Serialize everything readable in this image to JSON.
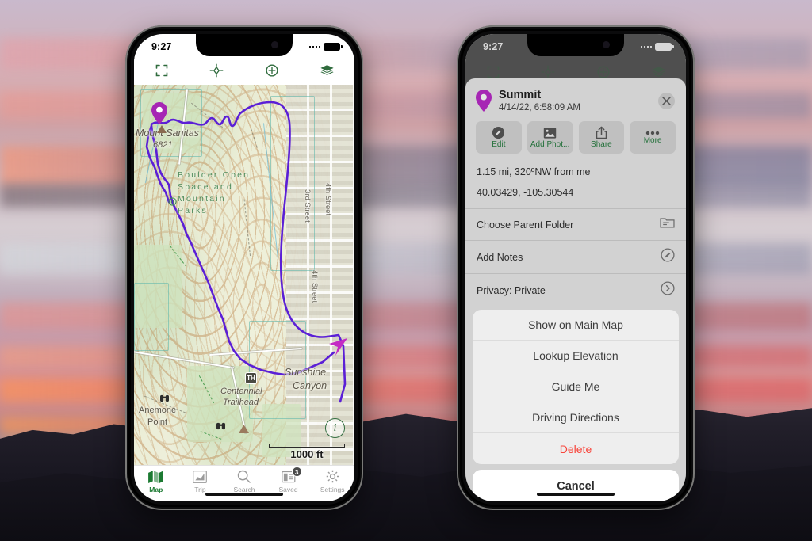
{
  "scene": {
    "description": "Two iPhone mockups on a mountain sunset photo background"
  },
  "left_phone": {
    "status": {
      "time": "9:27"
    },
    "toolbar": [
      {
        "name": "fullscreen-icon",
        "label": "Fullscreen"
      },
      {
        "name": "locate-icon",
        "label": "Locate Me"
      },
      {
        "name": "add-waypoint-icon",
        "label": "Add"
      },
      {
        "name": "layers-icon",
        "label": "Layers"
      }
    ],
    "map": {
      "labels": {
        "peak_name": "Mount Sanitas",
        "peak_elevation": "6821",
        "park": "Boulder Open Space and Mountain Parks",
        "canyon": "Sunshine Canyon",
        "trailhead": "Centennial Trailhead",
        "trailhead_icon": "TH",
        "viewpoint": "Anemone Point",
        "street_3rd": "3rd Street",
        "street_4th": "4th Street",
        "street_4th_b": "4th Street"
      },
      "scale_label": "1000 ft",
      "info_glyph": "i",
      "route_color": "#5b1fd6",
      "pin_color": "#a626b4"
    },
    "tabs": [
      {
        "label": "Map",
        "icon": "map-icon",
        "active": true,
        "badge": ""
      },
      {
        "label": "Trip",
        "icon": "chart-icon",
        "active": false,
        "badge": ""
      },
      {
        "label": "Search",
        "icon": "search-icon",
        "active": false,
        "badge": ""
      },
      {
        "label": "Saved",
        "icon": "saved-icon",
        "active": false,
        "badge": "3"
      },
      {
        "label": "Settings",
        "icon": "gear-icon",
        "active": false,
        "badge": ""
      }
    ]
  },
  "right_phone": {
    "status": {
      "time": "9:27"
    },
    "sheet": {
      "title": "Summit",
      "subtitle": "4/14/22, 6:58:09 AM",
      "close_label": "✕",
      "actions": [
        {
          "label": "Edit",
          "icon": "pencil-icon"
        },
        {
          "label": "Add Phot...",
          "icon": "photo-icon"
        },
        {
          "label": "Share",
          "icon": "share-icon"
        },
        {
          "label": "More",
          "icon": "ellipsis-icon"
        }
      ],
      "info_lines": [
        "1.15 mi, 320ºNW from me",
        "40.03429, -105.30544"
      ],
      "options": [
        {
          "label": "Choose Parent Folder",
          "icon": "folder-icon"
        },
        {
          "label": "Add Notes",
          "icon": "pencil-circle-icon"
        },
        {
          "label": "Privacy: Private",
          "icon": "chevron-right-icon"
        }
      ],
      "action_sheet": {
        "items": [
          {
            "label": "Show on Main Map",
            "destructive": false
          },
          {
            "label": "Lookup Elevation",
            "destructive": false
          },
          {
            "label": "Guide Me",
            "destructive": false
          },
          {
            "label": "Driving Directions",
            "destructive": false
          },
          {
            "label": "Delete",
            "destructive": true
          }
        ],
        "cancel_label": "Cancel"
      }
    }
  },
  "colors": {
    "green_accent": "#1c7a32",
    "purple_route": "#5b1fd6",
    "magenta_pin": "#a626b4",
    "destructive_red": "#f8443a"
  }
}
